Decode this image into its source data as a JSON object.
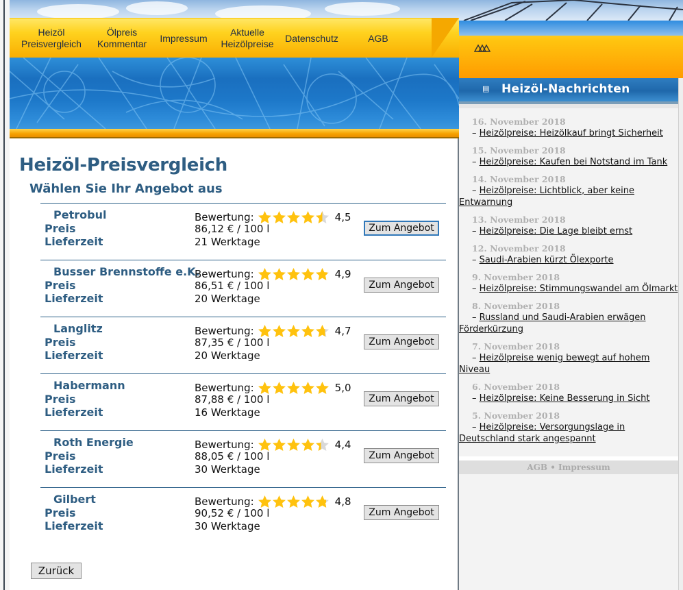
{
  "nav": {
    "items": [
      {
        "label": "Heizöl\nPreisvergleich"
      },
      {
        "label": "Ölpreis\nKommentar"
      },
      {
        "label": "Impressum"
      },
      {
        "label": "Aktuelle\nHeizölpreise"
      },
      {
        "label": "Datenschutz"
      },
      {
        "label": "AGB"
      }
    ]
  },
  "main": {
    "title": "Heizöl-Preisvergleich",
    "subtitle": "Wählen Sie Ihr Angebot aus",
    "labels": {
      "rating": "Bewertung:",
      "price": "Preis",
      "delivery": "Lieferzeit",
      "button": "Zum Angebot"
    },
    "offers": [
      {
        "name": "Petrobul",
        "rating": 4.5,
        "rating_text": "4,5",
        "price": "86,12 € / 100 l",
        "delivery": "21 Werktage",
        "focused": true
      },
      {
        "name": "Busser Brennstoffe e.K.",
        "rating": 4.9,
        "rating_text": "4,9",
        "price": "86,51 € / 100 l",
        "delivery": "20 Werktage",
        "focused": false
      },
      {
        "name": "Langlitz",
        "rating": 4.7,
        "rating_text": "4,7",
        "price": "87,35 € / 100 l",
        "delivery": "20 Werktage",
        "focused": false
      },
      {
        "name": "Habermann",
        "rating": 5.0,
        "rating_text": "5,0",
        "price": "87,88 € / 100 l",
        "delivery": "16 Werktage",
        "focused": false
      },
      {
        "name": "Roth Energie",
        "rating": 4.4,
        "rating_text": "4,4",
        "price": "88,05 € / 100 l",
        "delivery": "30 Werktage",
        "focused": false
      },
      {
        "name": "Gilbert",
        "rating": 4.8,
        "rating_text": "4,8",
        "price": "90,52 € / 100 l",
        "delivery": "30 Werktage",
        "focused": false
      }
    ],
    "back_label": "Zurück"
  },
  "sidebar": {
    "title": "Heizöl-Nachrichten",
    "news": [
      {
        "date": "16. November 2018",
        "title": "Heizölpreise: Heizölkauf bringt Sicherheit"
      },
      {
        "date": "15. November 2018",
        "title": "Heizölpreise: Kaufen bei Notstand im Tank"
      },
      {
        "date": "14. November 2018",
        "title": "Heizölpreise: Lichtblick, aber keine Entwarnung"
      },
      {
        "date": "13. November 2018",
        "title": "Heizölpreise: Die Lage bleibt ernst"
      },
      {
        "date": "12. November 2018",
        "title": "Saudi-Arabien kürzt Ölexporte"
      },
      {
        "date": "9. November 2018",
        "title": "Heizölpreise: Stimmungswandel am Ölmarkt"
      },
      {
        "date": "8. November 2018",
        "title": "Russland und Saudi-Arabien erwägen Förderkürzung"
      },
      {
        "date": "7. November 2018",
        "title": "Heizölpreise wenig bewegt auf hohem Niveau"
      },
      {
        "date": "6. November 2018",
        "title": "Heizölpreise: Keine Besserung in Sicht"
      },
      {
        "date": "5. November 2018",
        "title": "Heizölpreise: Versorgungslage in Deutschland stark angespannt"
      }
    ],
    "footer": "AGB • Impressum"
  },
  "colors": {
    "heading": "#2e5d82",
    "nav_yellow": "#ffd21f",
    "band_blue": "#1d78c9",
    "star": "#ffc20e",
    "star_empty": "#d9d9d9"
  }
}
